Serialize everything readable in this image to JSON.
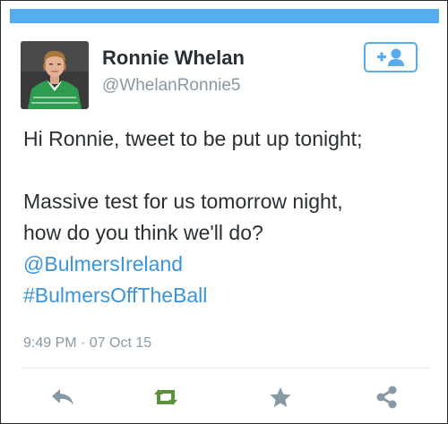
{
  "colors": {
    "accent": "#55acee",
    "link": "#3b94d9",
    "retweet_active": "#5c913b",
    "icon_gray": "#8899a6",
    "text": "#292f33"
  },
  "user": {
    "name": "Ronnie Whelan",
    "handle": "@WhelanRonnie5",
    "avatar_icon": "profile-photo"
  },
  "follow_button": {
    "icon": "follow-user-icon"
  },
  "tweet": {
    "line1": "Hi Ronnie, tweet to be put up tonight;",
    "line2": "Massive test for us tomorrow night,",
    "line3": "how do you think we'll do?",
    "mention": "@BulmersIreland",
    "hashtag": "#BulmersOffTheBall",
    "timestamp": "9:49 PM · 07 Oct 15"
  },
  "actions": [
    {
      "icon": "reply-icon",
      "active": false
    },
    {
      "icon": "retweet-icon",
      "active": true
    },
    {
      "icon": "favorite-star-icon",
      "active": false
    },
    {
      "icon": "share-icon",
      "active": false
    }
  ]
}
